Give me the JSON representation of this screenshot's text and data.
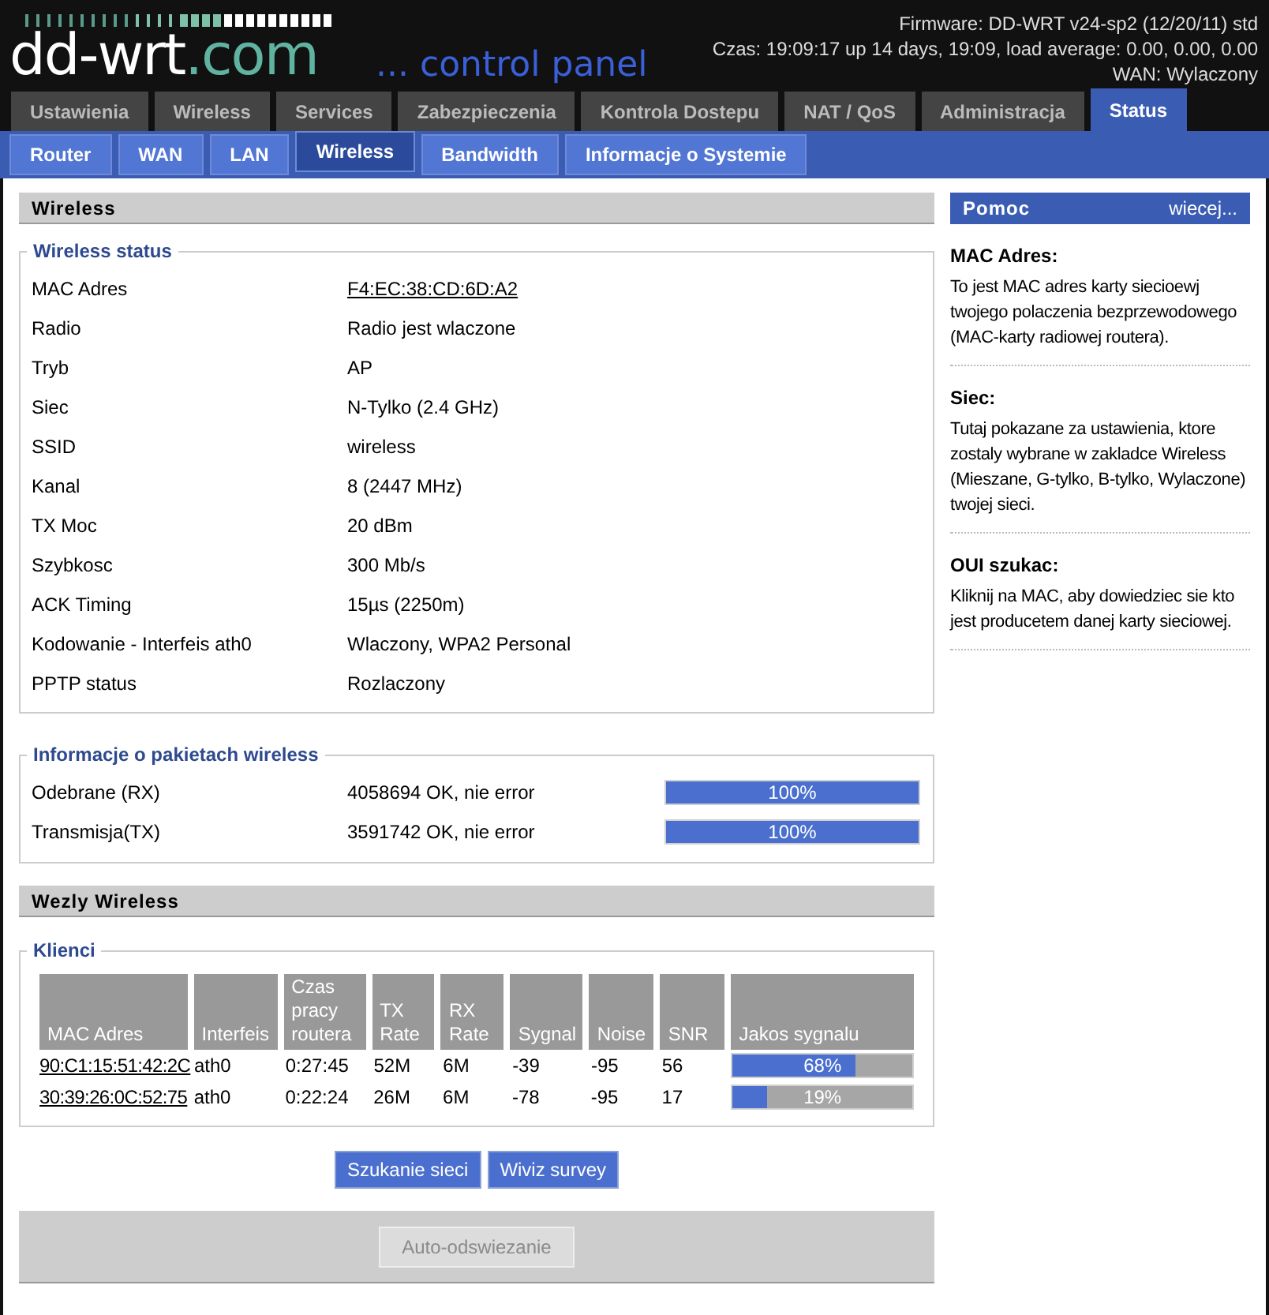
{
  "header": {
    "logo_main": "dd-wrt",
    "logo_suffix": ".com",
    "subtitle": "... control panel",
    "firmware": "Firmware: DD-WRT v24-sp2 (12/20/11) std",
    "time": "Czas: 19:09:17 up 14 days, 19:09, load average: 0.00, 0.00, 0.00",
    "wan": "WAN: Wylaczony"
  },
  "tabs": [
    {
      "label": "Ustawienia",
      "selected": false
    },
    {
      "label": "Wireless",
      "selected": false
    },
    {
      "label": "Services",
      "selected": false
    },
    {
      "label": "Zabezpieczenia",
      "selected": false
    },
    {
      "label": "Kontrola Dostepu",
      "selected": false
    },
    {
      "label": "NAT / QoS",
      "selected": false
    },
    {
      "label": "Administracja",
      "selected": false
    },
    {
      "label": "Status",
      "selected": true
    }
  ],
  "subtabs": [
    {
      "label": "Router",
      "selected": false
    },
    {
      "label": "WAN",
      "selected": false
    },
    {
      "label": "LAN",
      "selected": false
    },
    {
      "label": "Wireless",
      "selected": true
    },
    {
      "label": "Bandwidth",
      "selected": false
    },
    {
      "label": "Informacje o Systemie",
      "selected": false
    }
  ],
  "section_title": "Wireless",
  "wireless_status": {
    "title": "Wireless status",
    "rows": [
      {
        "label": "MAC Adres",
        "value": "F4:EC:38:CD:6D:A2",
        "kind": "link"
      },
      {
        "label": "Radio",
        "value": "Radio jest wlaczone",
        "kind": "text"
      },
      {
        "label": "Tryb",
        "value": "AP",
        "kind": "text"
      },
      {
        "label": "Siec",
        "value": "N-Tylko (2.4 GHz)",
        "kind": "text"
      },
      {
        "label": "SSID",
        "value": "wireless",
        "kind": "text"
      },
      {
        "label": "Kanal",
        "value": "8 (2447 MHz)",
        "kind": "text"
      },
      {
        "label": "TX Moc",
        "value": "20 dBm",
        "kind": "text"
      },
      {
        "label": "Szybkosc",
        "value": "300 Mb/s",
        "kind": "text"
      },
      {
        "label": "ACK Timing",
        "value": "15µs (2250m)",
        "kind": "text"
      },
      {
        "label": "Kodowanie - Interfeis ath0",
        "value": "Wlaczony, WPA2 Personal",
        "kind": "text"
      },
      {
        "label": "PPTP status",
        "value": "Rozlaczony",
        "kind": "text"
      }
    ]
  },
  "packets": {
    "title": "Informacje o pakietach wireless",
    "rows": [
      {
        "label": "Odebrane (RX)",
        "value": "4058694 OK, nie error",
        "level": 1,
        "reading": "100%"
      },
      {
        "label": "Transmisja(TX)",
        "value": "3591742 OK, nie error",
        "level": 1,
        "reading": "100%"
      }
    ]
  },
  "nodes_title": "Wezly Wireless",
  "clients": {
    "title": "Klienci",
    "columns": [
      "MAC Adres",
      "Interfeis",
      "Czas pracy routera",
      "TX Rate",
      "RX Rate",
      "Sygnal",
      "Noise",
      "SNR",
      "Jakos sygnalu"
    ],
    "rows": [
      {
        "mac": "90:C1:15:51:42:2C",
        "interface": "ath0",
        "uptime": "0:27:45",
        "tx": "52M",
        "rx": "6M",
        "signal": "-39",
        "noise": "-95",
        "snr": "56",
        "level": 0.68,
        "reading": "68%"
      },
      {
        "mac": "30:39:26:0C:52:75",
        "interface": "ath0",
        "uptime": "0:22:24",
        "tx": "26M",
        "rx": "6M",
        "signal": "-78",
        "noise": "-95",
        "snr": "17",
        "level": 0.19,
        "reading": "19%"
      }
    ]
  },
  "buttons": [
    "Szukanie sieci",
    "Wiviz survey"
  ],
  "refresh_button": {
    "label": "Auto-odswiezanie",
    "disabled": true
  },
  "help": {
    "title": "Pomoc",
    "more": "wiecej...",
    "entries": [
      {
        "title": "MAC Adres:",
        "text": "To jest MAC adres karty siecioewj twojego polaczenia bezprzewodowego (MAC-karty radiowej routera)."
      },
      {
        "title": "Siec:",
        "text": "Tutaj pokazane za ustawienia, ktore zostaly wybrane w zakladce Wireless (Mieszane, G-tylko, B-tylko, Wylaczone) twojej sieci."
      },
      {
        "title": "OUI szukac:",
        "text": "Kliknij na MAC, aby dowiedziec sie kto jest producetem danej karty sieciowej."
      }
    ]
  }
}
